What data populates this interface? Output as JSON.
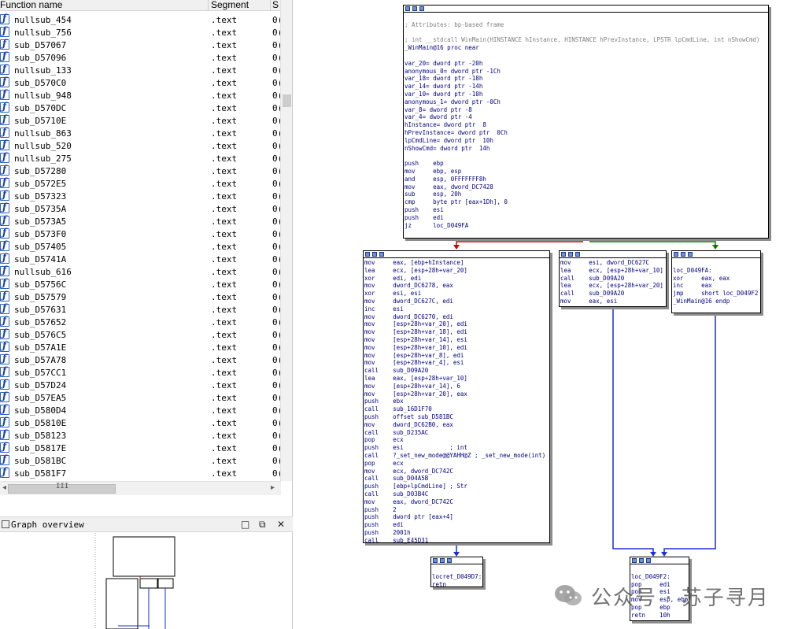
{
  "functions_pane": {
    "col_name": "Function name",
    "col_segment": "Segment",
    "col_start": "S",
    "rows": [
      {
        "name": "nullsub_454",
        "segment": ".text",
        "start": "0("
      },
      {
        "name": "nullsub_756",
        "segment": ".text",
        "start": "0("
      },
      {
        "name": "sub_D57067",
        "segment": ".text",
        "start": "0("
      },
      {
        "name": "sub_D57096",
        "segment": ".text",
        "start": "0("
      },
      {
        "name": "nullsub_133",
        "segment": ".text",
        "start": "0("
      },
      {
        "name": "sub_D570C0",
        "segment": ".text",
        "start": "0("
      },
      {
        "name": "nullsub_948",
        "segment": ".text",
        "start": "0("
      },
      {
        "name": "sub_D570DC",
        "segment": ".text",
        "start": "0("
      },
      {
        "name": "sub_D5710E",
        "segment": ".text",
        "start": "0("
      },
      {
        "name": "nullsub_863",
        "segment": ".text",
        "start": "0("
      },
      {
        "name": "nullsub_520",
        "segment": ".text",
        "start": "0("
      },
      {
        "name": "nullsub_275",
        "segment": ".text",
        "start": "0("
      },
      {
        "name": "sub_D57280",
        "segment": ".text",
        "start": "0("
      },
      {
        "name": "sub_D572E5",
        "segment": ".text",
        "start": "0("
      },
      {
        "name": "sub_D57323",
        "segment": ".text",
        "start": "0("
      },
      {
        "name": "sub_D5735A",
        "segment": ".text",
        "start": "0("
      },
      {
        "name": "sub_D573A5",
        "segment": ".text",
        "start": "0("
      },
      {
        "name": "sub_D573F0",
        "segment": ".text",
        "start": "0("
      },
      {
        "name": "sub_D57405",
        "segment": ".text",
        "start": "0("
      },
      {
        "name": "sub_D5741A",
        "segment": ".text",
        "start": "0("
      },
      {
        "name": "nullsub_616",
        "segment": ".text",
        "start": "0("
      },
      {
        "name": "sub_D5756C",
        "segment": ".text",
        "start": "0("
      },
      {
        "name": "sub_D57579",
        "segment": ".text",
        "start": "0("
      },
      {
        "name": "sub_D57631",
        "segment": ".text",
        "start": "0("
      },
      {
        "name": "sub_D57652",
        "segment": ".text",
        "start": "0("
      },
      {
        "name": "sub_D576C5",
        "segment": ".text",
        "start": "0("
      },
      {
        "name": "sub_D57A1E",
        "segment": ".text",
        "start": "0("
      },
      {
        "name": "sub_D57A78",
        "segment": ".text",
        "start": "0("
      },
      {
        "name": "sub_D57CC1",
        "segment": ".text",
        "start": "0("
      },
      {
        "name": "sub_D57D24",
        "segment": ".text",
        "start": "0("
      },
      {
        "name": "sub_D57EA5",
        "segment": ".text",
        "start": "0("
      },
      {
        "name": "sub_D580D4",
        "segment": ".text",
        "start": "0("
      },
      {
        "name": "sub_D5810E",
        "segment": ".text",
        "start": "0("
      },
      {
        "name": "sub_D58123",
        "segment": ".text",
        "start": "0("
      },
      {
        "name": "sub_D5817E",
        "segment": ".text",
        "start": "0("
      },
      {
        "name": "sub_D581BC",
        "segment": ".text",
        "start": "0("
      },
      {
        "name": "sub_D581F7",
        "segment": ".text",
        "start": "0("
      }
    ],
    "hscroll_grip": "III"
  },
  "overview": {
    "title": "Graph overview",
    "btn_min": "□",
    "btn_restore": "⧉",
    "btn_close": "✕"
  },
  "nodes": {
    "entry": [
      "",
      "; Attributes: bp-based frame",
      "",
      "; int __stdcall WinMain(HINSTANCE hInstance, HINSTANCE hPrevInstance, LPSTR lpCmdLine, int nShowCmd)",
      "_WinMain@16 proc near",
      "",
      "var_20= dword ptr -20h",
      "anonymous_0= dword ptr -1Ch",
      "var_18= dword ptr -18h",
      "var_14= dword ptr -14h",
      "var_10= dword ptr -10h",
      "anonymous_1= dword ptr -0Ch",
      "var_8= dword ptr -8",
      "var_4= dword ptr -4",
      "hInstance= dword ptr  8",
      "hPrevInstance= dword ptr  0Ch",
      "lpCmdLine= dword ptr  10h",
      "nShowCmd= dword ptr  14h",
      "",
      "push    ebp",
      "mov     ebp, esp",
      "and     esp, 0FFFFFFF8h",
      "mov     eax, dword_DC7428",
      "sub     esp, 20h",
      "cmp     byte ptr [eax+1Dh], 0",
      "push    esi",
      "push    edi",
      "jz      loc_D049FA"
    ],
    "left": [
      "mov     eax, [ebp+hInstance]",
      "lea     ecx, [esp+28h+var_20]",
      "xor     edi, edi",
      "mov     dword_DC6278, eax",
      "xor     esi, esi",
      "mov     dword_DC627C, edi",
      "inc     esi",
      "mov     dword_DC6270, edi",
      "mov     [esp+28h+var_20], edi",
      "mov     [esp+28h+var_18], edi",
      "mov     [esp+28h+var_14], esi",
      "mov     [esp+28h+var_10], edi",
      "mov     [esp+28h+var_8], edi",
      "mov     [esp+28h+var_4], esi",
      "call    sub_D09A20",
      "lea     eax, [esp+28h+var_10]",
      "mov     [esp+28h+var_14], 6",
      "mov     [esp+28h+var_20], eax",
      "push    ebx",
      "call    sub_16D1F70",
      "push    offset sub_D581BC",
      "mov     dword_DC62B0, eax",
      "call    sub_D235AC",
      "pop     ecx",
      "push    esi             ; int",
      "call    ?_set_new_mode@@YAHH@Z ; _set_new_mode(int)",
      "pop     ecx",
      "mov     ecx, dword_DC742C",
      "call    sub_D04A5B",
      "push    [ebp+lpCmdLine] ; Str",
      "call    sub_D03B4C",
      "mov     eax, dword_DC742C",
      "push    2",
      "push    dword ptr [eax+4]",
      "push    edi",
      "push    2001h",
      "call    sub_E45D31"
    ],
    "middle": [
      "mov     esi, dword_DC627C",
      "lea     ecx, [esp+28h+var_10]",
      "call    sub_D09A20",
      "lea     ecx, [esp+28h+var_20]",
      "call    sub_D09A20",
      "mov     eax, esi"
    ],
    "right": [
      "",
      "loc_D049FA:",
      "xor     eax, eax",
      "inc     eax",
      "jmp     short loc_D049F2",
      "_WinMain@16 endp"
    ],
    "locret": [
      "",
      "locret_D049D7:",
      "retn"
    ],
    "tail": [
      "",
      "loc_D049F2:",
      "pop     edi",
      "pop     esi",
      "mov     esp, ebp",
      "pop     ebp",
      "retn    10h"
    ]
  },
  "watermark": {
    "text": "公众号 · 苏子寻月"
  },
  "colors": {
    "edge_false": "#d00000",
    "edge_true": "#008000",
    "edge_normal": "#1c2ed8"
  }
}
